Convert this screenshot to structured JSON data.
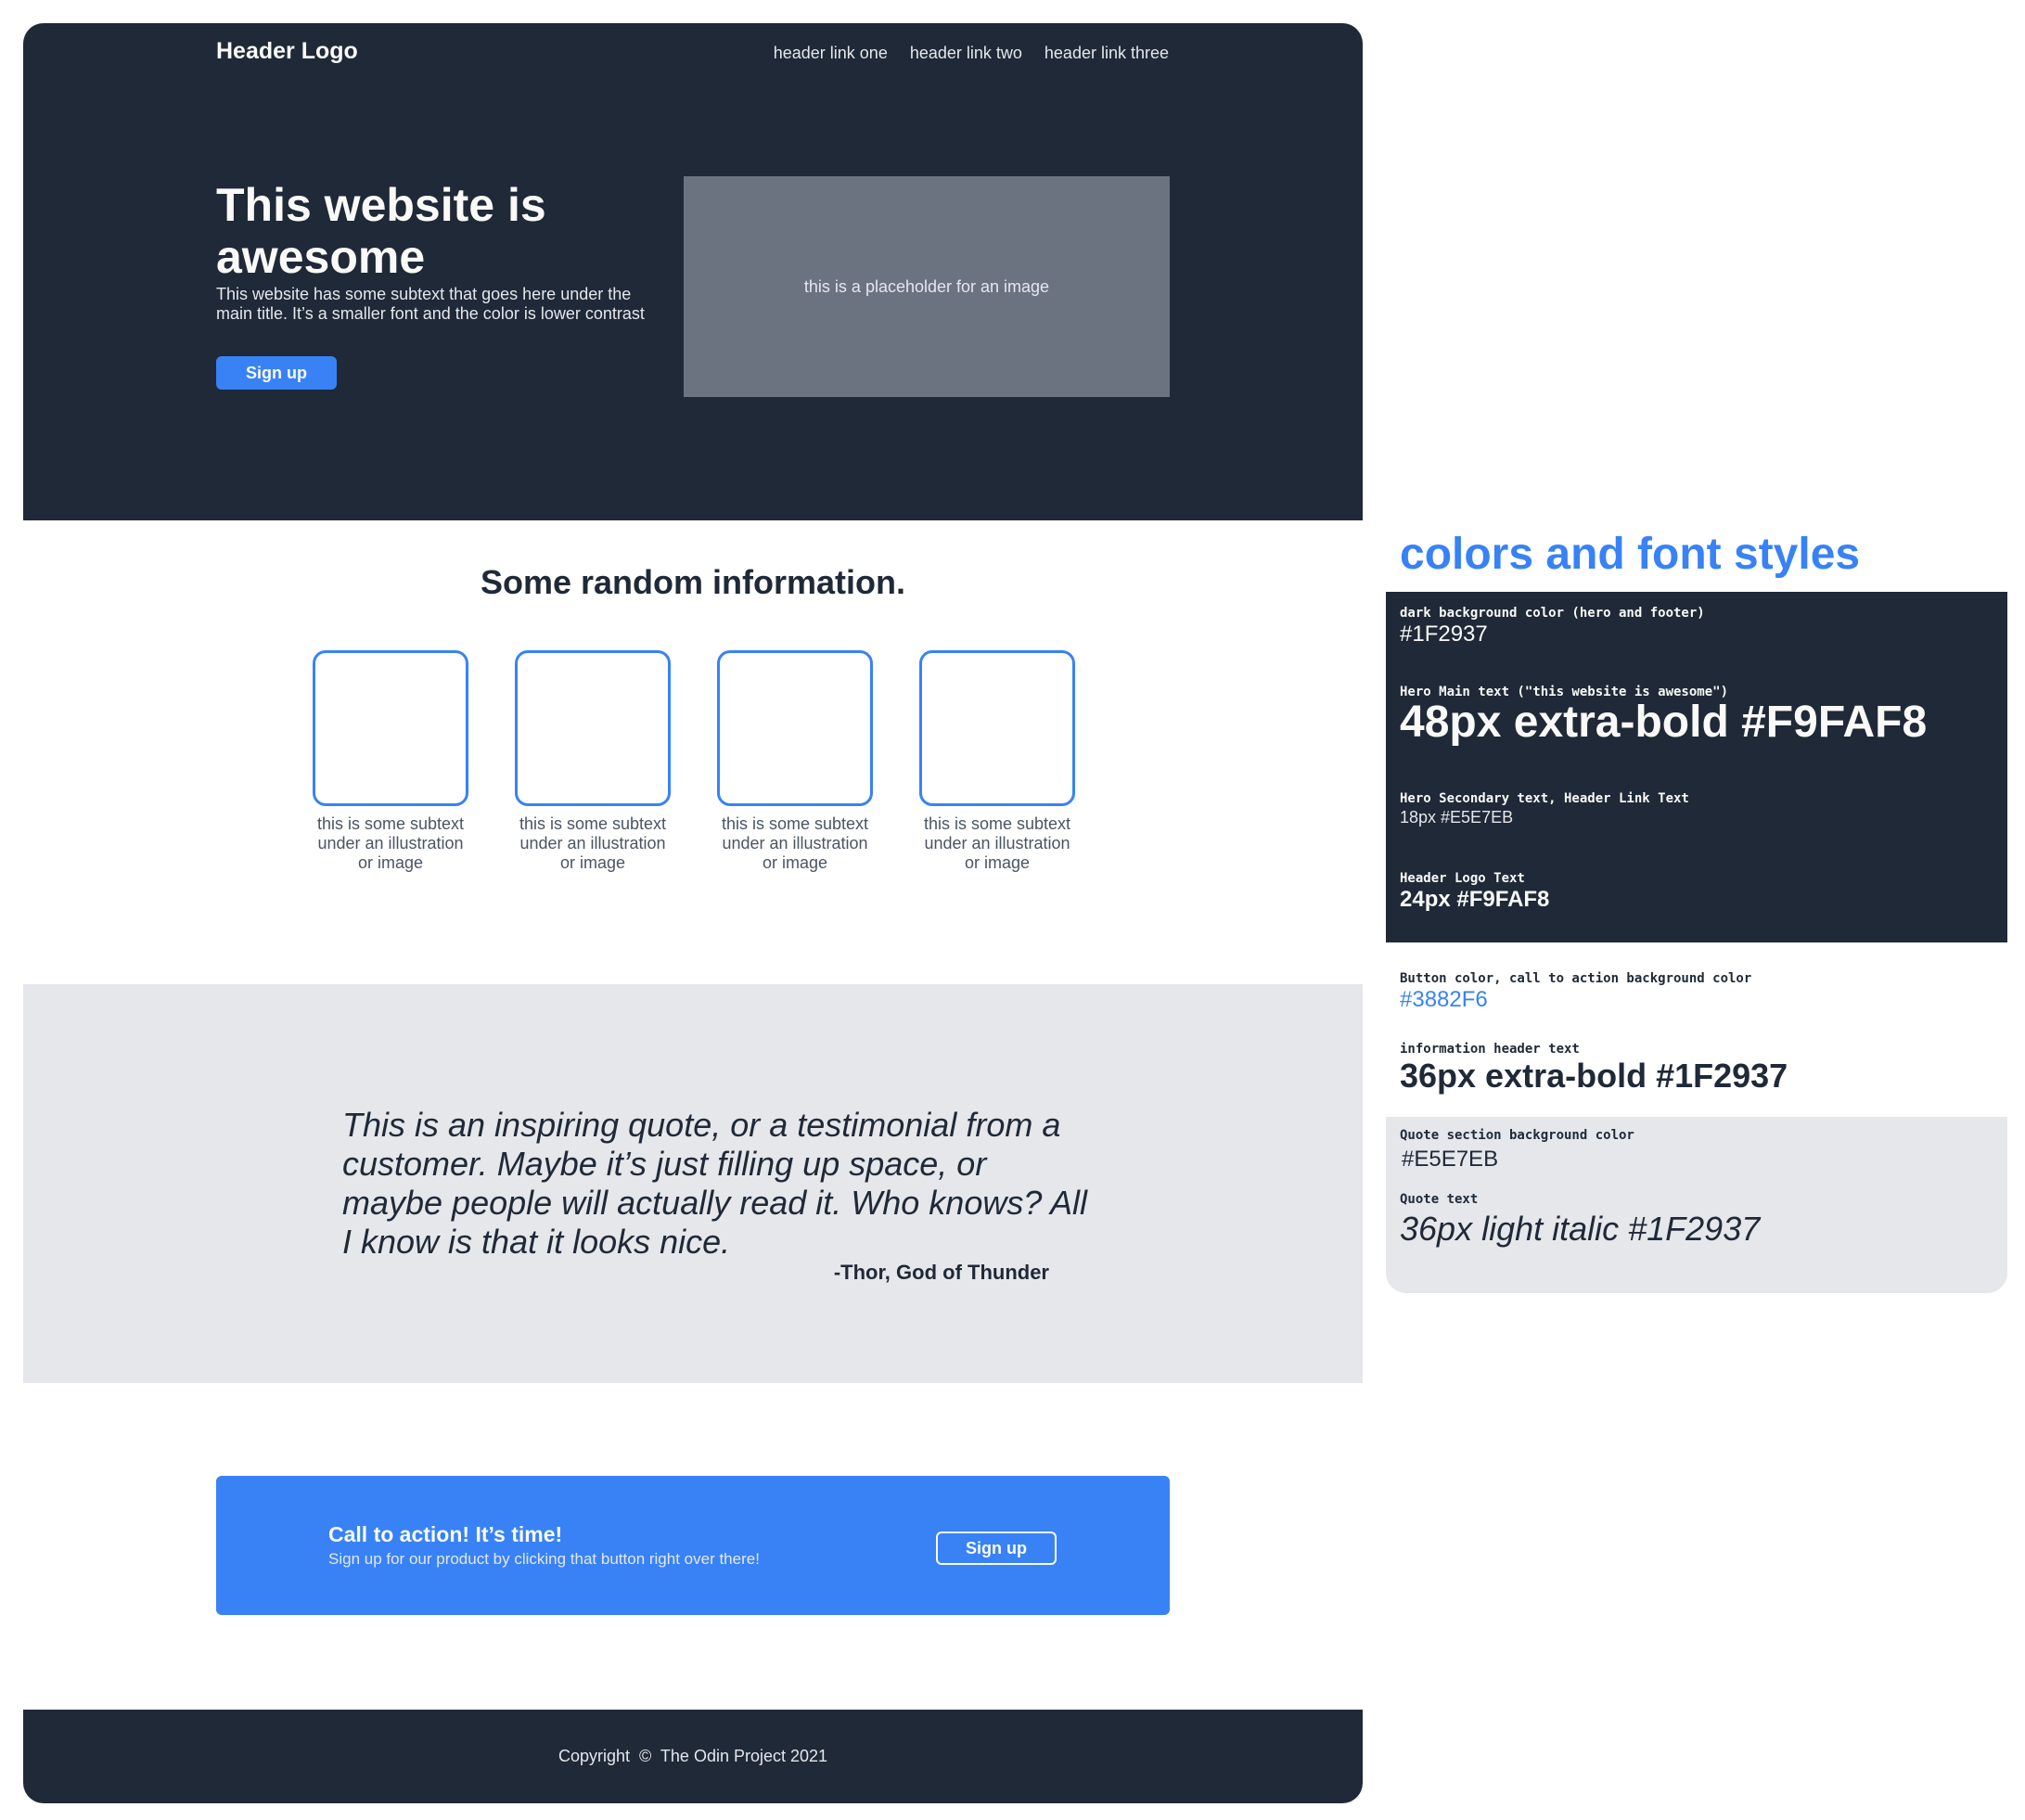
{
  "header": {
    "logo": "Header Logo",
    "links": [
      "header link one",
      "header link two",
      "header link three"
    ]
  },
  "hero": {
    "title": "This website is awesome",
    "subtext": "This website has some subtext that goes here under the main title.  It’s a smaller font and the color is lower contrast",
    "button": "Sign up",
    "image_placeholder": "this is a placeholder for an image"
  },
  "info": {
    "title": "Some random information.",
    "cards": [
      {
        "text": "this is some subtext under an illustration or image"
      },
      {
        "text": "this is some subtext under an illustration or image"
      },
      {
        "text": "this is some subtext under an illustration or image"
      },
      {
        "text": "this is some subtext under an illustration or image"
      }
    ]
  },
  "quote": {
    "text": "This is an inspiring quote, or a testimonial from a customer.  Maybe it’s just filling up space, or maybe people will actually read it. Who knows?  All I know is that it looks nice.",
    "author": "-Thor, God of Thunder"
  },
  "cta": {
    "title": "Call to action! It’s time!",
    "subtext": "Sign up for our product by clicking that button right over there!",
    "button": "Sign up"
  },
  "footer": {
    "copyright": "Copyright  ©  The Odin Project 2021"
  },
  "style_guide": {
    "title": "colors and font styles",
    "dark_bg": {
      "label": "dark background color (hero and footer)",
      "value": "#1F2937"
    },
    "hero_main": {
      "label": "Hero Main text (\"this website is awesome\")",
      "value": "48px extra-bold #F9FAF8"
    },
    "hero_secondary": {
      "label": "Hero Secondary text, Header Link Text",
      "value": "18px #E5E7EB"
    },
    "header_logo": {
      "label": "Header Logo Text",
      "value": "24px #F9FAF8"
    },
    "button_color": {
      "label": "Button color, call to action background color",
      "value": "#3882F6"
    },
    "info_header": {
      "label": "information header text",
      "value": "36px extra-bold #1F2937"
    },
    "quote_bg": {
      "label": "Quote section background color",
      "value": "#E5E7EB"
    },
    "quote_text": {
      "label": "Quote text",
      "value": "36px light italic #1F2937"
    }
  },
  "colors": {
    "dark": "#1F2937",
    "accent": "#3882F6",
    "light_text": "#F9FAF8",
    "secondary_text": "#E5E7EB",
    "quote_bg": "#E5E7EB",
    "placeholder_bg": "#6B7280"
  }
}
